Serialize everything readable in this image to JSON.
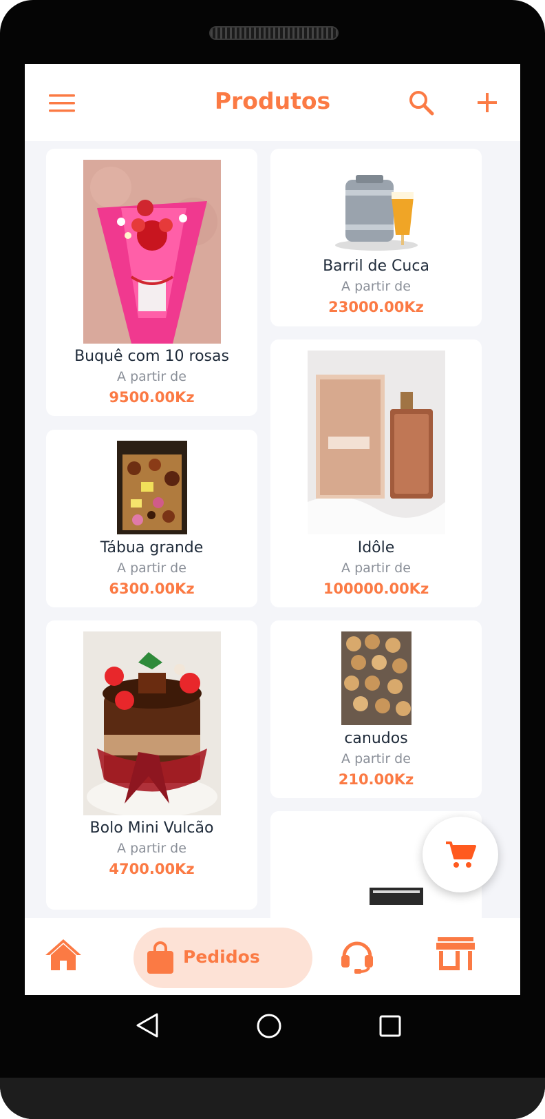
{
  "header": {
    "title": "Produtos",
    "icons": {
      "menu": "menu-icon",
      "search": "search-icon",
      "add": "plus-icon"
    }
  },
  "products": [
    {
      "name": "Buquê com 10 rosas",
      "from_label": "A partir de",
      "price": "9500.00Kz"
    },
    {
      "name": "Barril de Cuca",
      "from_label": "A partir de",
      "price": "23000.00Kz"
    },
    {
      "name": "Tábua grande",
      "from_label": "A partir de",
      "price": "6300.00Kz"
    },
    {
      "name": "Idôle",
      "from_label": "A partir de",
      "price": "100000.00Kz"
    },
    {
      "name": "Bolo Mini Vulcão",
      "from_label": "A partir de",
      "price": "4700.00Kz"
    },
    {
      "name": "canudos",
      "from_label": "A partir de",
      "price": "210.00Kz"
    },
    {
      "name": "",
      "from_label": "",
      "price": ""
    }
  ],
  "bottom_nav": {
    "active_label": "Pedidos",
    "items": [
      "home-icon",
      "shopping-bag-icon",
      "headset-icon",
      "store-icon"
    ]
  },
  "fab": {
    "icon": "cart-icon"
  },
  "colors": {
    "accent": "#fb7a44",
    "accent_light": "#fde2d6",
    "background": "#f4f5f9"
  }
}
